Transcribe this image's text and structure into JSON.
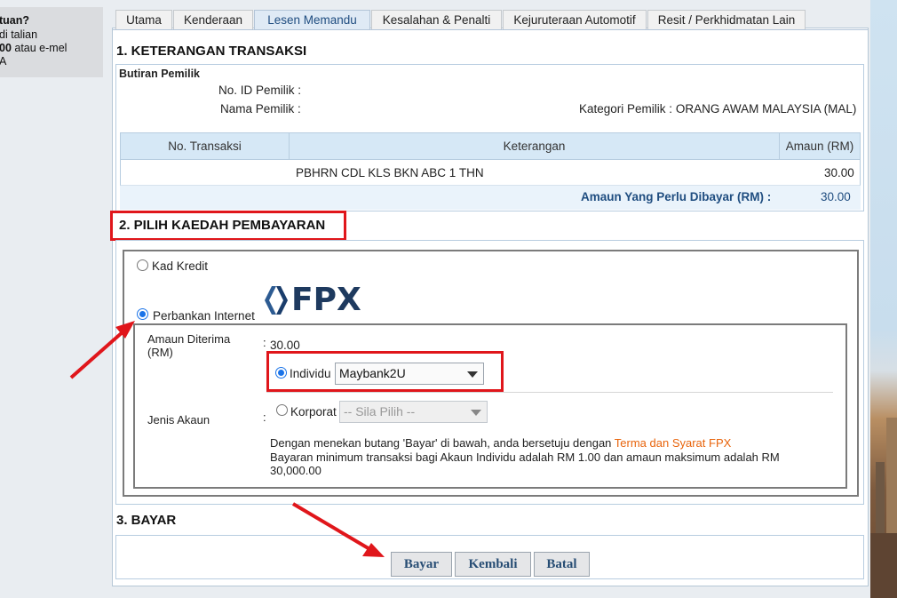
{
  "help_box": {
    "line1": "tuan?",
    "line2": "di talian",
    "line3_bold": "00",
    "line3_rest": " atau e-mel",
    "line4": "A"
  },
  "tabs": [
    {
      "label": "Utama"
    },
    {
      "label": "Kenderaan"
    },
    {
      "label": "Lesen Memandu"
    },
    {
      "label": "Kesalahan & Penalti"
    },
    {
      "label": "Kejuruteraan Automotif"
    },
    {
      "label": "Resit / Perkhidmatan Lain"
    }
  ],
  "section1": {
    "title": "1. KETERANGAN TRANSAKSI",
    "owner_heading": "Butiran Pemilik",
    "owner_id_label": "No. ID Pemilik :",
    "owner_name_label": "Nama Pemilik :",
    "owner_category_label": "Kategori Pemilik :",
    "owner_category_value": "ORANG AWAM MALAYSIA (MAL)",
    "table": {
      "headers": [
        "No. Transaksi",
        "Keterangan",
        "Amaun (RM)"
      ],
      "row": {
        "transaction": "",
        "description": "PBHRN CDL KLS BKN ABC 1 THN",
        "amount": "30.00"
      },
      "total_label": "Amaun Yang Perlu Dibayar (RM) :",
      "total_value": "30.00"
    }
  },
  "section2": {
    "title": "2. PILIH KAEDAH PEMBAYARAN",
    "credit_card_label": "Kad Kredit",
    "internet_banking_label": "Perbankan Internet",
    "fpx_logo_text": "FPX",
    "amount_received_label_1": "Amaun Diterima",
    "amount_received_label_2": "(RM)",
    "colon": ":",
    "amount_received_value": "30.00",
    "individual_label": "Individu",
    "individual_bank": "Maybank2U",
    "account_type_label": "Jenis Akaun",
    "corporate_label": "Korporat",
    "corporate_placeholder": "-- Sila Pilih --",
    "terms_text": "Dengan menekan butang 'Bayar' di bawah, anda bersetuju dengan ",
    "terms_link": "Terma dan Syarat FPX",
    "min_text_1": "Bayaran minimum transaksi bagi Akaun Individu adalah RM 1.00 dan amaun maksimum adalah RM",
    "min_text_2": "30,000.00"
  },
  "section3": {
    "title": "3. BAYAR",
    "pay_button": "Bayar",
    "back_button": "Kembali",
    "cancel_button": "Batal"
  },
  "colors": {
    "accent": "#1f4d80",
    "highlight": "#e0161b",
    "link": "#e8640c",
    "table_header": "#d6e8f6"
  }
}
